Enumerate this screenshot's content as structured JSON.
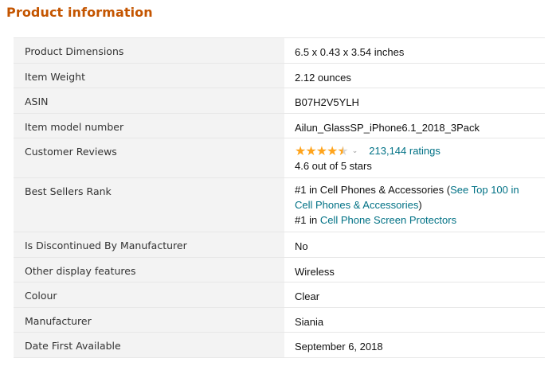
{
  "section_title": "Product information",
  "colors": {
    "title": "#c45500",
    "link": "#007185",
    "star": "#ffa41c",
    "label_bg": "#f3f3f3"
  },
  "rows": [
    {
      "label": "Product Dimensions",
      "value": "6.5 x 0.43 x 3.54 inches"
    },
    {
      "label": "Item Weight",
      "value": "2.12 ounces"
    },
    {
      "label": "ASIN",
      "value": "B07H2V5YLH"
    },
    {
      "label": "Item model number",
      "value": "Ailun_GlassSP_iPhone6.1_2018_3Pack"
    }
  ],
  "reviews": {
    "label": "Customer Reviews",
    "rating": 4.6,
    "stars_glyph_full": "★★★★",
    "stars_glyph_half": "★",
    "caret_icon": "chevron-down-icon",
    "caret": "⌄",
    "ratings_count": "213,144 ratings",
    "summary": "4.6 out of 5 stars"
  },
  "best_sellers": {
    "label": "Best Sellers Rank",
    "rank1_prefix": "#1 in Cell Phones & Accessories (",
    "rank1_link": "See Top 100 in Cell Phones & Accessories",
    "rank1_suffix": ")",
    "rank2_prefix": "#1 in ",
    "rank2_link": "Cell Phone Screen Protectors"
  },
  "rows_after": [
    {
      "label": "Is Discontinued By Manufacturer",
      "value": "No"
    },
    {
      "label": "Other display features",
      "value": "Wireless"
    },
    {
      "label": "Colour",
      "value": "Clear"
    },
    {
      "label": "Manufacturer",
      "value": "Siania"
    },
    {
      "label": "Date First Available",
      "value": "September 6, 2018"
    }
  ]
}
